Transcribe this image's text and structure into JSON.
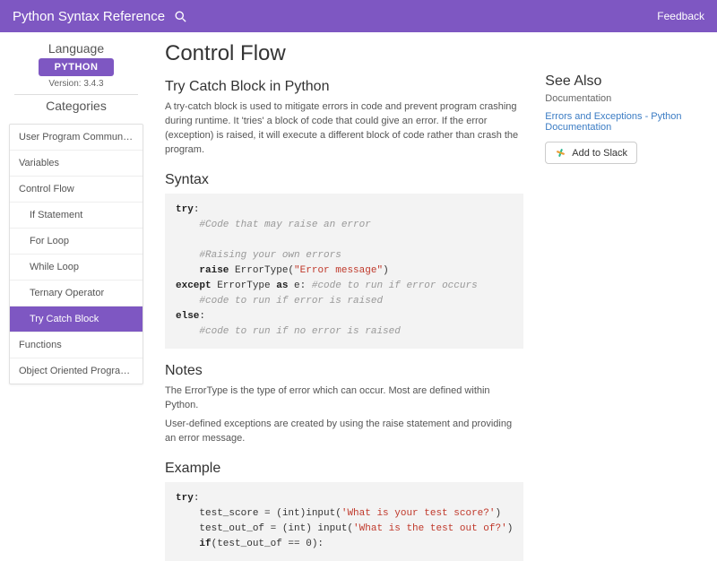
{
  "header": {
    "title": "Python Syntax Reference",
    "feedback": "Feedback"
  },
  "sidebar": {
    "language_label": "Language",
    "language_button": "PYTHON",
    "version": "Version: 3.4.3",
    "categories_label": "Categories",
    "items": [
      {
        "label": "User Program Communi…",
        "sub": false,
        "active": false
      },
      {
        "label": "Variables",
        "sub": false,
        "active": false
      },
      {
        "label": "Control Flow",
        "sub": false,
        "active": false
      },
      {
        "label": "If Statement",
        "sub": true,
        "active": false
      },
      {
        "label": "For Loop",
        "sub": true,
        "active": false
      },
      {
        "label": "While Loop",
        "sub": true,
        "active": false
      },
      {
        "label": "Ternary Operator",
        "sub": true,
        "active": false
      },
      {
        "label": "Try Catch Block",
        "sub": true,
        "active": true
      },
      {
        "label": "Functions",
        "sub": false,
        "active": false
      },
      {
        "label": "Object Oriented Progra…",
        "sub": false,
        "active": false
      }
    ]
  },
  "content": {
    "h1": "Control Flow",
    "h2_intro": "Try Catch Block in Python",
    "intro": "A try-catch block is used to mitigate errors in code and prevent program crashing during runtime. It 'tries' a block of code that could give an error. If the error (exception) is raised, it will execute a different block of code rather than crash the program.",
    "h2_syntax": "Syntax",
    "h2_notes": "Notes",
    "note1": "The ErrorType is the type of error which can occur. Most are defined within Python.",
    "note2": "User-defined exceptions are created by using the raise statement and providing an error message.",
    "h2_example": "Example"
  },
  "aside": {
    "title": "See Also",
    "doc_label": "Documentation",
    "link": "Errors and Exceptions - Python Documentation",
    "slack": "Add to Slack"
  }
}
